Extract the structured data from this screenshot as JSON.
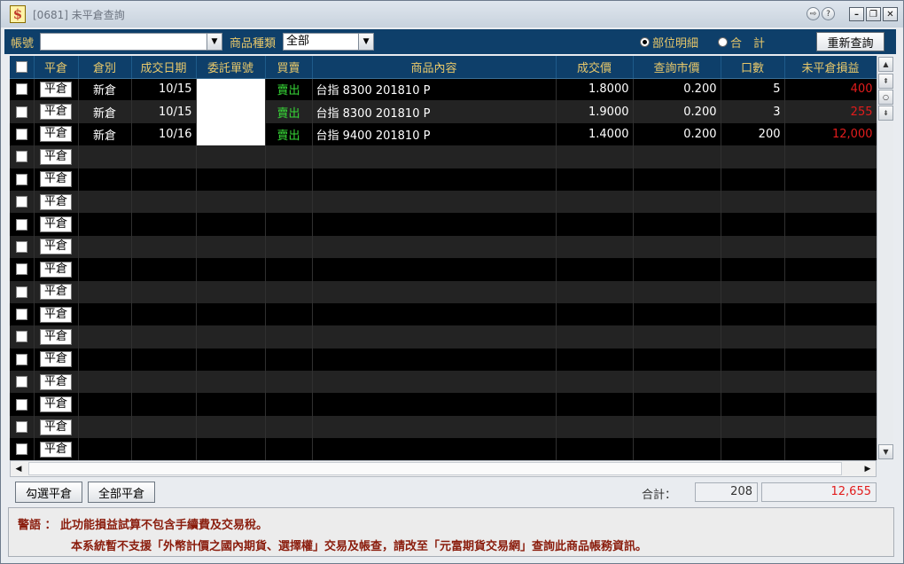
{
  "window": {
    "title": "[0681] 未平倉查詢",
    "app_icon_glyph": "$"
  },
  "toolbar": {
    "account_label": "帳號",
    "account_value": "",
    "category_label": "商品種類",
    "category_value": "全部",
    "radio_detail_label": "部位明細",
    "radio_total_label": "合　計",
    "radio_selected": "部位明細",
    "refresh_label": "重新查詢"
  },
  "table": {
    "headers": [
      "平倉",
      "倉別",
      "成交日期",
      "委託單號",
      "買賣",
      "商品內容",
      "成交價",
      "查詢市價",
      "口數",
      "未平倉損益"
    ],
    "close_button_label": "平倉",
    "rows": [
      {
        "type": "新倉",
        "date": "10/15",
        "order_no": "",
        "side": "賣出",
        "product": "台指 8300 201810 P",
        "price": "1.8000",
        "market": "0.200",
        "qty": "5",
        "pnl": "400"
      },
      {
        "type": "新倉",
        "date": "10/15",
        "order_no": "",
        "side": "賣出",
        "product": "台指 8300 201810 P",
        "price": "1.9000",
        "market": "0.200",
        "qty": "3",
        "pnl": "255"
      },
      {
        "type": "新倉",
        "date": "10/16",
        "order_no": "",
        "side": "賣出",
        "product": "台指 9400 201810 P",
        "price": "1.4000",
        "market": "0.200",
        "qty": "200",
        "pnl": "12,000"
      }
    ],
    "empty_row_count": 14
  },
  "footer": {
    "select_close_label": "勾選平倉",
    "close_all_label": "全部平倉",
    "total_label": "合計：",
    "total_qty": "208",
    "total_pnl": "12,655"
  },
  "warning": {
    "line1": "警語 ： 此功能損益試算不包含手續費及交易稅。",
    "line2": "本系統暫不支援「外幣計價之國內期貨、選擇權」交易及帳查，請改至「元富期貨交易網」查詢此商品帳務資訊。"
  },
  "colors": {
    "header_bg": "#0e3f6a",
    "header_text": "#e8c86a",
    "sell_text": "#37d637",
    "pnl_text": "#e21c1c",
    "warning_text": "#8a1c0c"
  }
}
